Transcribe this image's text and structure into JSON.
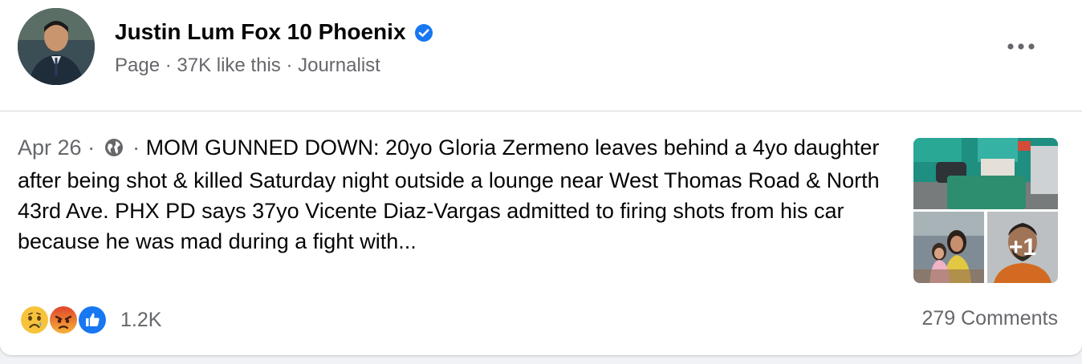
{
  "author": {
    "name": "Justin Lum Fox 10 Phoenix",
    "meta": "Page · 37K like this · Journalist"
  },
  "icons": {
    "verified": "verified-badge-icon",
    "more": "more-options-icon",
    "audience": "globe-icon",
    "reactions": [
      "sad-reaction-icon",
      "angry-reaction-icon",
      "like-reaction-icon"
    ]
  },
  "post": {
    "date": "Apr 26",
    "separator": " · ",
    "text": "MOM GUNNED DOWN: 20yo Gloria Zermeno leaves behind a 4yo daughter after being shot & killed Saturday night outside a lounge near West Thomas Road & North 43rd Ave. PHX PD says 37yo Vicente Diaz-Vargas admitted to firing shots from his car because he was mad during a fight with..."
  },
  "photos": {
    "more_label": "+1"
  },
  "footer": {
    "reaction_count": "1.2K",
    "comments": "279 Comments"
  },
  "colors": {
    "accent": "#1877f2",
    "secondary_text": "#65676b",
    "primary_text": "#050505"
  }
}
